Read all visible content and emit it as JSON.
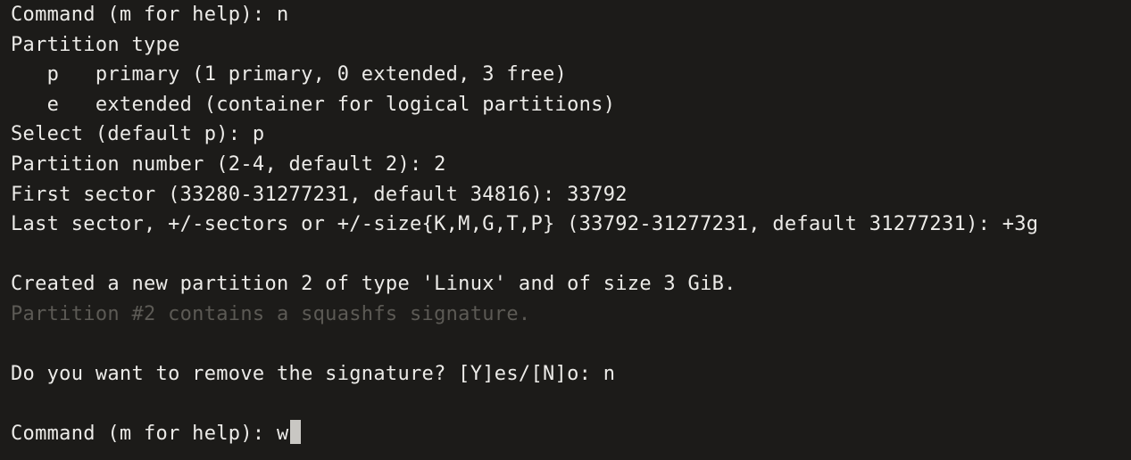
{
  "terminal": {
    "lines": [
      {
        "text": "Command (m for help): n",
        "dim": false
      },
      {
        "text": "Partition type",
        "dim": false
      },
      {
        "text": "   p   primary (1 primary, 0 extended, 3 free)",
        "dim": false
      },
      {
        "text": "   e   extended (container for logical partitions)",
        "dim": false
      },
      {
        "text": "Select (default p): p",
        "dim": false
      },
      {
        "text": "Partition number (2-4, default 2): 2",
        "dim": false
      },
      {
        "text": "First sector (33280-31277231, default 34816): 33792",
        "dim": false
      },
      {
        "text": "Last sector, +/-sectors or +/-size{K,M,G,T,P} (33792-31277231, default 31277231): +3g",
        "dim": false
      },
      {
        "text": "",
        "dim": false
      },
      {
        "text": "Created a new partition 2 of type 'Linux' and of size 3 GiB.",
        "dim": false
      },
      {
        "text": "Partition #2 contains a squashfs signature.",
        "dim": true
      },
      {
        "text": "",
        "dim": false
      },
      {
        "text": "Do you want to remove the signature? [Y]es/[N]o: n",
        "dim": false
      },
      {
        "text": "",
        "dim": false
      },
      {
        "text": "Command (m for help): w",
        "dim": false,
        "cursor": true
      }
    ]
  },
  "colors": {
    "background": "#1c1b19",
    "foreground": "#ecebe8",
    "dim_text": "#5c5a55",
    "cursor": "#c9c7c3"
  }
}
